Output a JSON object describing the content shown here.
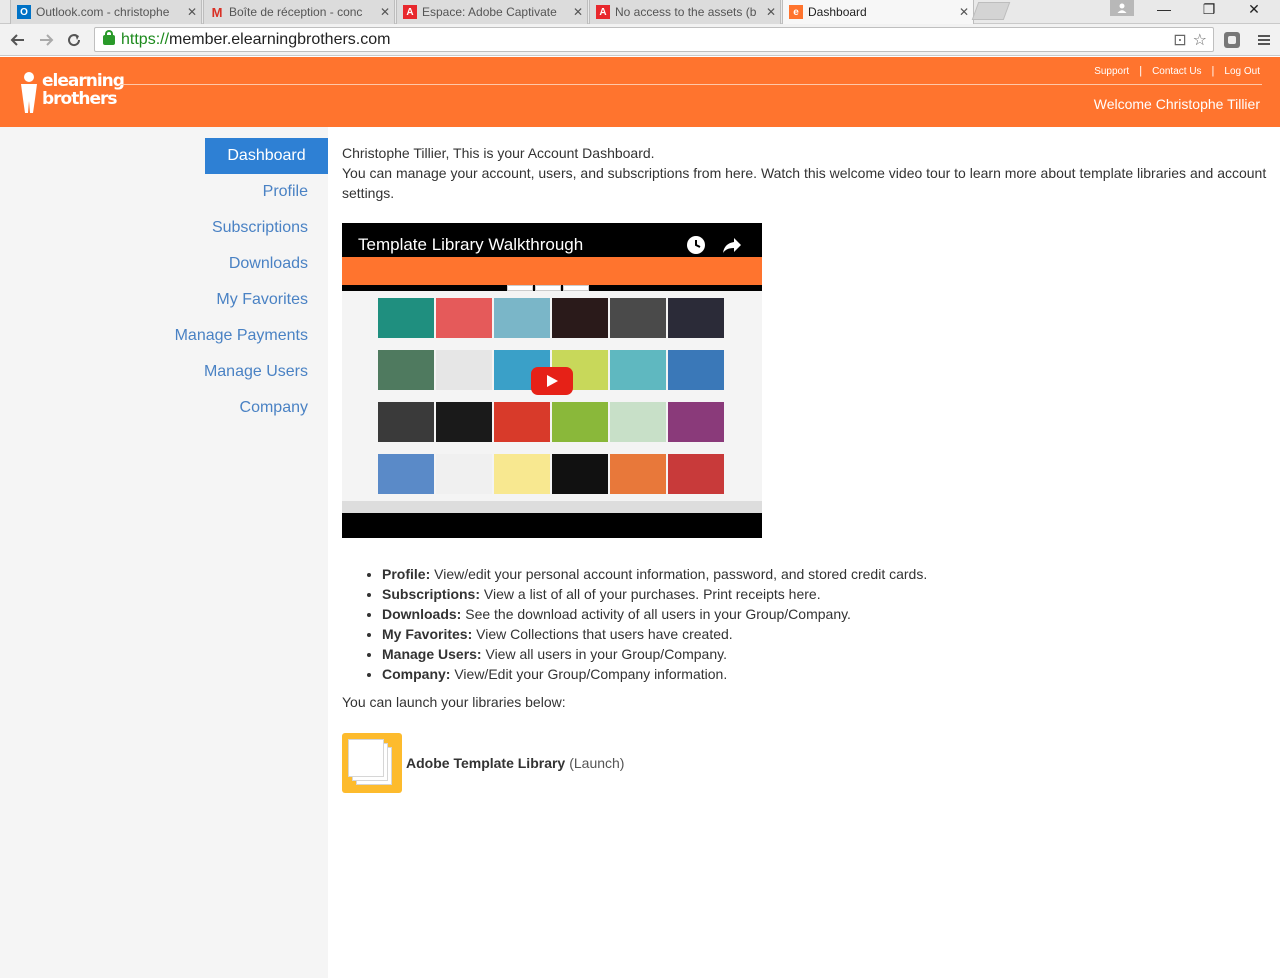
{
  "browser": {
    "tabs": [
      {
        "title": "Outlook.com - christophe",
        "favicon": "outlook-icon",
        "color": "#0072c6"
      },
      {
        "title": "Boîte de réception - conc",
        "favicon": "gmail-icon",
        "color": "#d93025"
      },
      {
        "title": "Espace: Adobe Captivate",
        "favicon": "adobe-icon",
        "color": "#e8282d"
      },
      {
        "title": "No access to the assets (b",
        "favicon": "adobe-icon",
        "color": "#e8282d"
      },
      {
        "title": "Dashboard",
        "favicon": "elearning-icon",
        "color": "#ff742e"
      }
    ],
    "url_scheme": "https://",
    "url_host": "member.elearningbrothers.com"
  },
  "header": {
    "logo_line1": "elearning",
    "logo_line2": "brothers",
    "links": [
      "Support",
      "Contact Us",
      "Log Out"
    ],
    "welcome": "Welcome Christophe Tillier",
    "accent": "#ff742e"
  },
  "sidebar": {
    "items": [
      {
        "label": "Dashboard",
        "active": true
      },
      {
        "label": "Profile"
      },
      {
        "label": "Subscriptions"
      },
      {
        "label": "Downloads"
      },
      {
        "label": "My Favorites"
      },
      {
        "label": "Manage Payments"
      },
      {
        "label": "Manage Users"
      },
      {
        "label": "Company"
      }
    ],
    "link_color": "#4a82c4",
    "active_color": "#2e80d4"
  },
  "main": {
    "intro_line1": "Christophe Tillier, This is your Account Dashboard.",
    "intro_line2": "You can manage your account, users, and subscriptions from here. Watch this welcome video tour to learn more about template libraries and account settings.",
    "video_title": "Template Library Walkthrough",
    "features": [
      {
        "term": "Profile:",
        "desc": " View/edit your personal account information, password, and stored credit cards."
      },
      {
        "term": "Subscriptions:",
        "desc": " View a list of all of your purchases. Print receipts here."
      },
      {
        "term": "Downloads:",
        "desc": " See the download activity of all users in your Group/Company."
      },
      {
        "term": "My Favorites:",
        "desc": " View Collections that users have created."
      },
      {
        "term": "Manage Users:",
        "desc": " View all users in your Group/Company."
      },
      {
        "term": "Company:",
        "desc": " View/Edit your Group/Company information."
      }
    ],
    "launch_text": "You can launch your libraries below:",
    "library_name": "Adobe Template Library",
    "library_launch": "(Launch)"
  }
}
